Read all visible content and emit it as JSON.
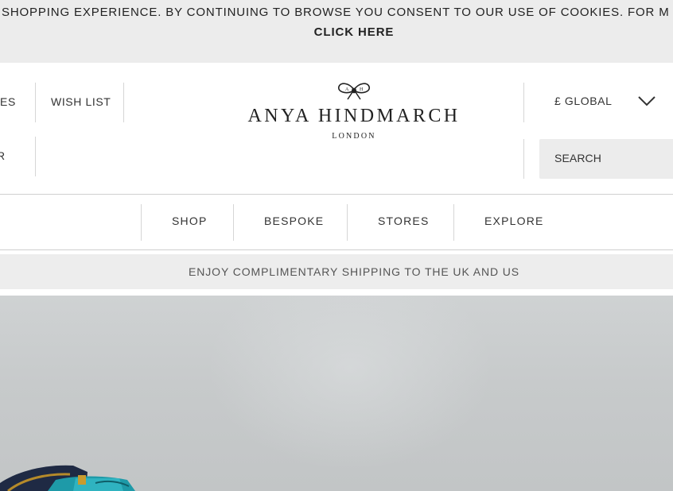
{
  "cookie_banner": {
    "message": "SHOPPING EXPERIENCE. BY CONTINUING TO BROWSE YOU CONSENT TO OUR USE OF COOKIES. FOR M",
    "link": "CLICK HERE"
  },
  "header": {
    "left_links": {
      "partial_top": "ES",
      "wish_list": "WISH LIST",
      "partial_bottom": "R"
    },
    "logo": {
      "brand": "ANYA HINDMARCH",
      "city": "LONDON"
    },
    "currency": {
      "label": "£ GLOBAL",
      "icon": "chevron-down-icon"
    },
    "search": {
      "label": "SEARCH"
    }
  },
  "nav": {
    "items": [
      "SHOP",
      "BESPOKE",
      "STORES",
      "EXPLORE"
    ]
  },
  "promo": {
    "text": "ENJOY COMPLIMENTARY SHIPPING TO THE UK AND US"
  },
  "colors": {
    "banner_bg": "#ececec",
    "promo_bg": "#ededed",
    "hero_bg": "#c7cacb",
    "bag_teal": "#1e9aa8",
    "bag_navy": "#1f2a44"
  }
}
